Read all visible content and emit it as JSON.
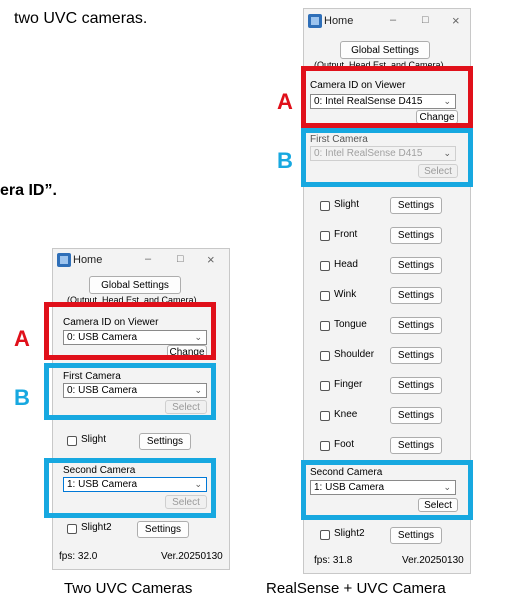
{
  "doc": {
    "top_text": "two UVC cameras.",
    "bold_text": "era ID”."
  },
  "colors": {
    "highlight_a": "#e0101a",
    "highlight_b": "#17a8e0"
  },
  "markers": {
    "a": "A",
    "b": "B"
  },
  "left_window": {
    "title": "Home",
    "minimize": "–",
    "maximize": "□",
    "close": "×",
    "global_settings": "Global Settings",
    "subtitle": "(Output, Head Est. and Camera)",
    "viewer_label": "Camera ID on Viewer",
    "viewer_value": "0: USB Camera",
    "change": "Change",
    "first_camera_label": "First Camera",
    "first_camera_value": "0: USB Camera",
    "select": "Select",
    "slight": "Slight",
    "settings": "Settings",
    "second_camera_label": "Second Camera",
    "second_camera_value": "1: USB Camera",
    "slight2": "Slight2",
    "fps": "fps: 32.0",
    "version": "Ver.20250130"
  },
  "right_window": {
    "title": "Home",
    "minimize": "–",
    "maximize": "□",
    "close": "×",
    "global_settings": "Global Settings",
    "subtitle": "(Output, Head Est. and Camera)",
    "viewer_label": "Camera ID on Viewer",
    "viewer_value": "0: Intel RealSense D415",
    "change": "Change",
    "first_camera_label": "First Camera",
    "first_camera_value": "0: Intel RealSense D415",
    "select": "Select",
    "settings": "Settings",
    "items": [
      "Slight",
      "Front",
      "Head",
      "Wink",
      "Tongue",
      "Shoulder",
      "Finger",
      "Knee",
      "Foot"
    ],
    "second_camera_label": "Second Camera",
    "second_camera_value": "1: USB Camera",
    "slight2": "Slight2",
    "fps": "fps: 31.8",
    "version": "Ver.20250130"
  },
  "captions": {
    "left": "Two UVC Cameras",
    "right": "RealSense + UVC Camera"
  },
  "icons": {
    "checkbox": "checkbox-icon",
    "dropdown": "chevron-down-icon",
    "app": "app-icon"
  }
}
